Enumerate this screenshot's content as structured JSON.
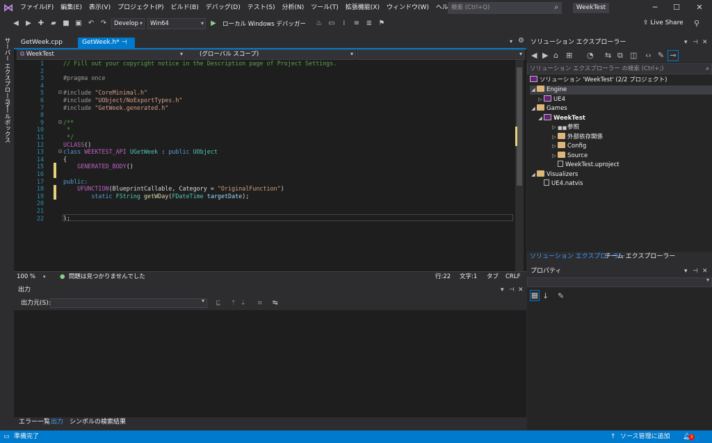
{
  "menu": [
    "ファイル(F)",
    "編集(E)",
    "表示(V)",
    "プロジェクト(P)",
    "ビルド(B)",
    "デバッグ(D)",
    "テスト(S)",
    "分析(N)",
    "ツール(T)",
    "拡張機能(X)",
    "ウィンドウ(W)",
    "ヘルプ(H)"
  ],
  "search_placeholder": "検索 (Ctrl+Q)",
  "window_title": "WeekTest",
  "toolbar": {
    "config": "Develop",
    "platform": "Win64",
    "debugger": "ローカル Windows デバッガー",
    "liveshare": "Live Share"
  },
  "left_tabs": [
    "サーバー エクスプローラー",
    "ツールボックス"
  ],
  "tabs": [
    "GetWeek.cpp",
    "GetWeek.h*"
  ],
  "nav": {
    "project": "WeekTest",
    "scope": "(グローバル スコープ)"
  },
  "code_lines": [
    "1",
    "2",
    "3",
    "4",
    "5",
    "6",
    "7",
    "8",
    "9",
    "10",
    "11",
    "12",
    "13",
    "14",
    "15",
    "16",
    "17",
    "18",
    "19",
    "20",
    "21",
    "22"
  ],
  "code": {
    "l1": "// Fill out your copyright notice in the Description page of Project Settings.",
    "l3a": "#pragma once",
    "inc": "#include",
    "inc1": "\"CoreMinimal.h\"",
    "inc2": "\"UObject/NoExportTypes.h\"",
    "inc3": "\"GetWeek.generated.h\"",
    "c9": "/**",
    "c10": " *",
    "c11": " */",
    "uclass": "UCLASS",
    "paren": "()",
    "kclass": "class",
    "api": "WEEKTEST_API",
    "cname": "UGetWeek",
    "colon": " : ",
    "kpublic": "public",
    "base": "UObject",
    "ob": "{",
    "gen": "GENERATED_BODY",
    "pub": "public:",
    "ufunc": "UFUNCTION",
    "ufargs": "(BlueprintCallable, Category = ",
    "ufcat": "\"OriginalFunction\"",
    "ufend": ")",
    "kstatic": "static",
    "fstr": "FString",
    "fname": "getWDay",
    "op": "(",
    "fdt": "FDateTime",
    "parm": "targetDate",
    "cend": ");",
    "cb": "};"
  },
  "editor_status": {
    "zoom": "100 %",
    "issues": "問題は見つかりませんでした",
    "line": "行:22",
    "col": "文字:1",
    "tab": "タブ",
    "eol": "CRLF"
  },
  "output": {
    "title": "出力",
    "source_label": "出力元(S):"
  },
  "bottom_tabs": [
    "エラー一覧",
    "出力",
    "シンボルの検索結果"
  ],
  "solution_explorer": {
    "title": "ソリューション エクスプローラー",
    "search": "ソリューション エクスプローラー の検索 (Ctrl+;)",
    "items": [
      "ソリューション 'WeekTest' (2/2 プロジェクト)",
      "Engine",
      "UE4",
      "Games",
      "WeekTest",
      "参照",
      "外部依存関係",
      "Config",
      "Source",
      "WeekTest.uproject",
      "Visualizers",
      "UE4.natvis"
    ],
    "tabs": [
      "ソリューション エクスプローラー",
      "チーム エクスプローラー"
    ]
  },
  "properties": {
    "title": "プロパティ"
  },
  "statusbar": {
    "ready": "準備完了",
    "source_control": "ソース管理に追加",
    "notif": "3"
  },
  "colors": {
    "accent": "#007acc",
    "background": "#1e1e1e"
  }
}
